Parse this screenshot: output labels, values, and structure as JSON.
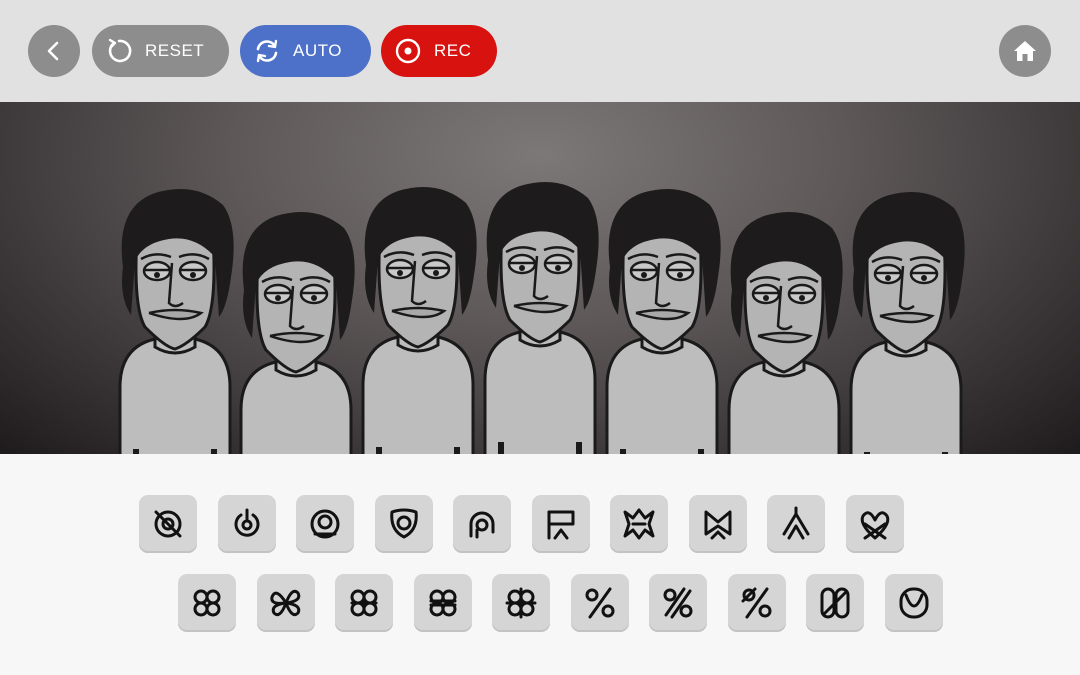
{
  "toolbar": {
    "back_icon": "chevron-left-icon",
    "reset_label": "RESET",
    "reset_icon": "reset-icon",
    "auto_label": "AUTO",
    "auto_icon": "refresh-icon",
    "rec_label": "REC",
    "rec_icon": "record-icon",
    "home_icon": "home-icon",
    "colors": {
      "grey": "#8d8d8d",
      "auto": "#4d71c8",
      "rec": "#d8120f"
    }
  },
  "stage": {
    "character_count": 7
  },
  "palette": {
    "row1": [
      {
        "name": "beat-sound-1",
        "icon": "crossed-circle-icon"
      },
      {
        "name": "beat-sound-2",
        "icon": "power-circle-icon"
      },
      {
        "name": "beat-sound-3",
        "icon": "target-ring-icon"
      },
      {
        "name": "beat-sound-4",
        "icon": "shield-ring-icon"
      },
      {
        "name": "beat-sound-5",
        "icon": "arch-ring-icon"
      },
      {
        "name": "effect-sound-1",
        "icon": "banner-chevron-icon"
      },
      {
        "name": "effect-sound-2",
        "icon": "spiky-star-icon"
      },
      {
        "name": "effect-sound-3",
        "icon": "crown-chevron-icon"
      },
      {
        "name": "effect-sound-4",
        "icon": "double-chevron-icon"
      },
      {
        "name": "effect-sound-5",
        "icon": "heart-loop-icon"
      }
    ],
    "row2": [
      {
        "name": "melody-sound-1",
        "icon": "quatrefoil-icon"
      },
      {
        "name": "melody-sound-2",
        "icon": "quatrefoil-outline-icon"
      },
      {
        "name": "melody-sound-3",
        "icon": "clover-icon"
      },
      {
        "name": "melody-sound-4",
        "icon": "clover-bars-icon"
      },
      {
        "name": "melody-sound-5",
        "icon": "clover-cross-icon"
      },
      {
        "name": "voice-sound-1",
        "icon": "percent-icon"
      },
      {
        "name": "voice-sound-2",
        "icon": "double-percent-icon"
      },
      {
        "name": "voice-sound-3",
        "icon": "percent-slash-icon"
      },
      {
        "name": "voice-sound-4",
        "icon": "double-oval-icon"
      },
      {
        "name": "voice-sound-5",
        "icon": "leaf-oval-icon"
      }
    ]
  }
}
